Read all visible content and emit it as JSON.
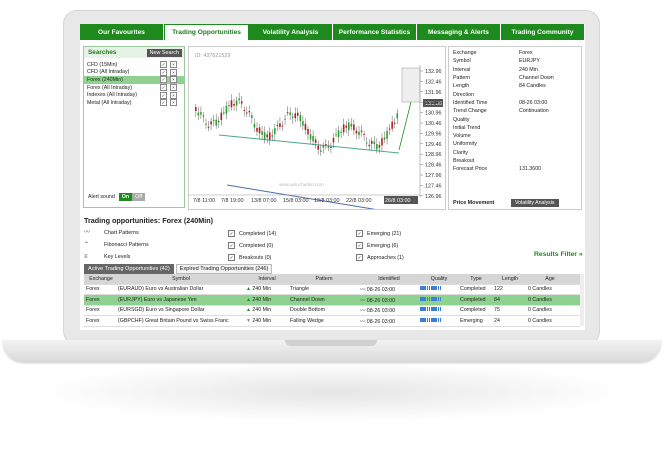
{
  "tabs": [
    "Our Favourites",
    "Trading Opportunities",
    "Volatility Analysis",
    "Performance Statistics",
    "Messaging & Alerts",
    "Trading Community"
  ],
  "searches": {
    "title": "Searches",
    "new_label": "New Search",
    "items": [
      "CFD (15Min)",
      "CFD (All Intraday)",
      "Forex (240Min)",
      "Forex (All Intraday)",
      "Indexes (All Intraday)",
      "Metal (All Intraday)"
    ],
    "alert_label": "Alert sound",
    "on": "On",
    "off": "Off"
  },
  "chart": {
    "id_label": "ID: 437621529",
    "watermark": "www.autochartist.com",
    "y_ticks": [
      "132.96",
      "132.46",
      "131.96",
      "131.46",
      "130.96",
      "130.46",
      "129.96",
      "129.46",
      "128.96",
      "128.46",
      "127.96",
      "127.46",
      "126.96"
    ],
    "current_price": "131.36",
    "x_ticks": [
      "7/8 11:00",
      "7/8 19:00",
      "13/8 07:00",
      "15/8 03:00",
      "18/8 03:00",
      "22/8 03:00",
      "26/8 03:00"
    ]
  },
  "details": {
    "rows": [
      {
        "k": "Exchange",
        "v": "Forex"
      },
      {
        "k": "Symbol",
        "v": "EURJPY"
      },
      {
        "k": "Interval",
        "v": "240 Min"
      },
      {
        "k": "Pattern",
        "v": "Channel Down"
      },
      {
        "k": "Length",
        "v": "84 Candles"
      },
      {
        "k": "Direction",
        "v": ""
      },
      {
        "k": "Identified Time",
        "v": "08-26 03:00"
      },
      {
        "k": "Trend Change",
        "v": "Continuation"
      },
      {
        "k": "Quality",
        "v": ""
      },
      {
        "k": "Initial Trend",
        "v": ""
      },
      {
        "k": "Volume",
        "v": ""
      },
      {
        "k": "Uniformity",
        "v": ""
      },
      {
        "k": "Clarity",
        "v": ""
      },
      {
        "k": "Breakout",
        "v": ""
      },
      {
        "k": "Forecast Price",
        "v": "131.3600"
      }
    ],
    "price_movement": "Price Movement",
    "volatility_analysis": "Volatility Analysis"
  },
  "opp": {
    "title": "Trading opportunities: Forex (240Min)",
    "types": [
      "Chart Patterns",
      "Fibonacci Patterns",
      "Key Levels"
    ],
    "status_a": [
      "Completed (14)",
      "Completed (0)",
      "Breakouts (0)"
    ],
    "status_b": [
      "Emerging (21)",
      "Emerging (6)",
      "Approaches (1)"
    ],
    "results_filter": "Results Filter »"
  },
  "subtabs": [
    "Active Trading Opportunities (42)",
    "Expired Trading Opportunities (246)"
  ],
  "table": {
    "headers": [
      "Exchange",
      "Symbol",
      "Interval",
      "Pattern",
      "Identified",
      "Quality",
      "Type",
      "Length",
      "Age"
    ],
    "rows": [
      [
        "Forex",
        "(EURAUD) Euro vs Australian Dollar",
        "240 Min",
        "Triangle",
        "08-26 03:00",
        "",
        "Completed",
        "122",
        "0 Candles"
      ],
      [
        "Forex",
        "(EURJPY) Euro vs Japanese Yen",
        "240 Min",
        "Channel Down",
        "08-26 03:00",
        "",
        "Completed",
        "84",
        "0 Candles"
      ],
      [
        "Forex",
        "(EURSGD) Euro vs Singapore Dollar",
        "240 Min",
        "Double Bottom",
        "08-26 03:00",
        "",
        "Completed",
        "75",
        "0 Candles"
      ],
      [
        "Forex",
        "(GBPCHF) Great Britain Pound vs Swiss Franc",
        "240 Min",
        "Falling Wedge",
        "08-26 03:00",
        "",
        "Emerging",
        "24",
        "0 Candles"
      ]
    ]
  },
  "colors": {
    "brand": "#1e8a1e",
    "selected": "#8fd28f",
    "quality": "#3a7fd5",
    "uniformity": "#e0a020",
    "breakout": "#8a2aa0"
  }
}
